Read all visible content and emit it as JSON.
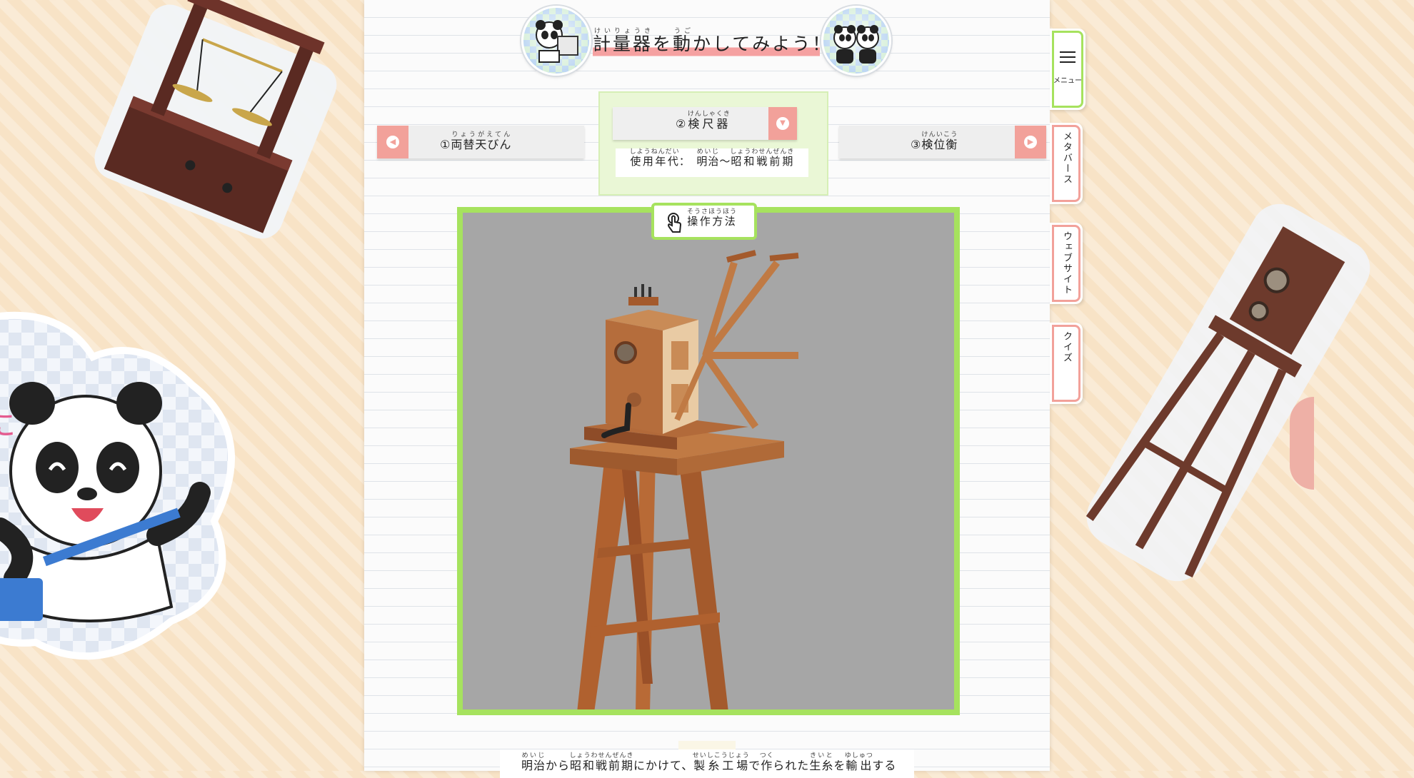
{
  "header": {
    "title_parts": [
      {
        "base": "計量器",
        "ruby": "けいりょうき"
      },
      {
        "text": "を"
      },
      {
        "base": "動",
        "ruby": "うご"
      },
      {
        "text": "かしてみよう！"
      }
    ]
  },
  "prev_item": {
    "number": "①",
    "base": "両替天びん",
    "ruby": "りょうがえてん"
  },
  "current_item": {
    "number": "②",
    "base": "検尺器",
    "ruby": "けんしゃくき"
  },
  "next_item": {
    "number": "③",
    "base": "検位衡",
    "ruby": "けんいこう"
  },
  "era": {
    "parts": [
      {
        "base": "使用年代",
        "ruby": "しようねんだい"
      },
      {
        "text": "：　"
      },
      {
        "base": "明治",
        "ruby": "めいじ"
      },
      {
        "text": "～"
      },
      {
        "base": "昭和戦前期",
        "ruby": "しょうわせんぜんき"
      }
    ]
  },
  "help": {
    "base": "操作方法",
    "ruby": "そうさほうほう"
  },
  "bottom_text": {
    "parts": [
      {
        "base": "明治",
        "ruby": "めいじ"
      },
      {
        "text": "から"
      },
      {
        "base": "昭和戦前期",
        "ruby": "しょうわせんぜんき"
      },
      {
        "text": "にかけて、"
      },
      {
        "base": "製糸工場",
        "ruby": "せいしこうじょう"
      },
      {
        "text": "で"
      },
      {
        "base": "作",
        "ruby": "つく"
      },
      {
        "text": "られた"
      },
      {
        "base": "生糸",
        "ruby": "きいと"
      },
      {
        "text": "を"
      },
      {
        "base": "輸出",
        "ruby": "ゆしゅつ"
      },
      {
        "text": "する"
      }
    ]
  },
  "side_menu": {
    "menu_label": "メニュー",
    "metaverse_label": "メタバース",
    "website_label": "ウェブサイト",
    "quiz_label": "クイズ"
  },
  "colors": {
    "accent_green": "#a6e25e",
    "accent_pink": "#f2a19a",
    "viewer_bg": "#a6a6a6",
    "page_bg": "#f8e3c6"
  },
  "icons": {
    "prev": "chevron-left-icon",
    "next": "chevron-right-icon",
    "dropdown": "chevron-down-icon",
    "help": "hand-pointer-icon",
    "menu": "hamburger-icon"
  }
}
